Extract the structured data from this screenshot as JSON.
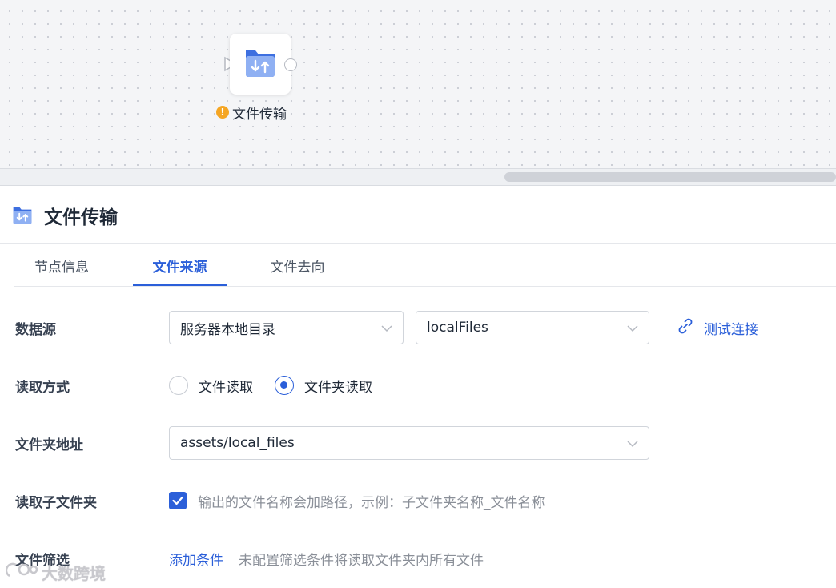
{
  "canvas": {
    "node": {
      "label": "文件传输",
      "icon": "folder-transfer-icon",
      "status_icon": "warning-icon",
      "status_glyph": "!"
    }
  },
  "panel": {
    "title": "文件传输",
    "icon": "folder-transfer-icon"
  },
  "tabs": [
    {
      "label": "节点信息",
      "active": false
    },
    {
      "label": "文件来源",
      "active": true
    },
    {
      "label": "文件去向",
      "active": false
    }
  ],
  "form": {
    "datasource": {
      "label": "数据源",
      "type_value": "服务器本地目录",
      "source_value": "localFiles",
      "test_link": "测试连接"
    },
    "read_mode": {
      "label": "读取方式",
      "options": [
        {
          "label": "文件读取",
          "checked": false
        },
        {
          "label": "文件夹读取",
          "checked": true
        }
      ]
    },
    "folder_path": {
      "label": "文件夹地址",
      "value": "assets/local_files"
    },
    "read_subfolders": {
      "label": "读取子文件夹",
      "checked": true,
      "hint": "输出的文件名称会加路径，示例：子文件夹名称_文件名称"
    },
    "file_filter": {
      "label": "文件筛选",
      "add_link": "添加条件",
      "hint": "未配置筛选条件将读取文件夹内所有文件"
    }
  },
  "watermark": {
    "text": "大数跨境"
  },
  "colors": {
    "accent": "#2b5fd9",
    "warning": "#f5a623",
    "hint": "#8a8f98"
  }
}
